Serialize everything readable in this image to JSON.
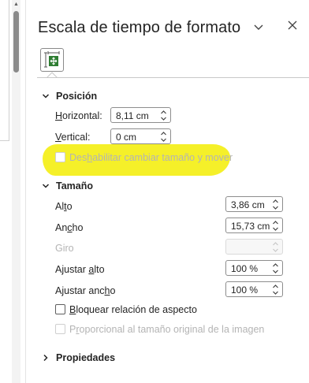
{
  "pane": {
    "title": "Escala de tiempo de formato",
    "title_chevron_icon": "chevron-down-icon",
    "close_icon": "close-icon",
    "tab_icon": "size-position-icon"
  },
  "position": {
    "header": "Posición",
    "horizontal_label_mnemonic": "H",
    "horizontal_label_rest": "orizontal:",
    "horizontal_value": "8,11 cm",
    "vertical_label_mnemonic": "V",
    "vertical_label_rest": "ertical:",
    "vertical_value": "0 cm",
    "no_resize_pre": "Des",
    "no_resize_mnemonic": "h",
    "no_resize_post": "abilitar cambiar tamaño y mover"
  },
  "size": {
    "header": "Tamaño",
    "alto_pre": "Al",
    "alto_mnemonic": "t",
    "alto_post": "o",
    "alto_value": "3,86 cm",
    "ancho_pre": "An",
    "ancho_mnemonic": "c",
    "ancho_post": "ho",
    "ancho_value": "15,73 cm",
    "giro_label": "Giro",
    "giro_value": "",
    "ajustar_alto_pre": "Ajustar ",
    "ajustar_alto_mnemonic": "a",
    "ajustar_alto_post": "lto",
    "ajustar_alto_value": "100 %",
    "ajustar_ancho_pre": "Ajustar anc",
    "ajustar_ancho_mnemonic": "h",
    "ajustar_ancho_post": "o",
    "ajustar_ancho_value": "100 %",
    "lock_mnemonic": "B",
    "lock_rest": "loquear relación de aspecto",
    "lock_checked": false,
    "relative_pre": "P",
    "relative_mnemonic": "r",
    "relative_post": "oporcional al tamaño original de la imagen"
  },
  "properties": {
    "header": "Propiedades"
  },
  "colors": {
    "highlight": "#f4ef1e",
    "icon_green": "#2e7d32"
  }
}
